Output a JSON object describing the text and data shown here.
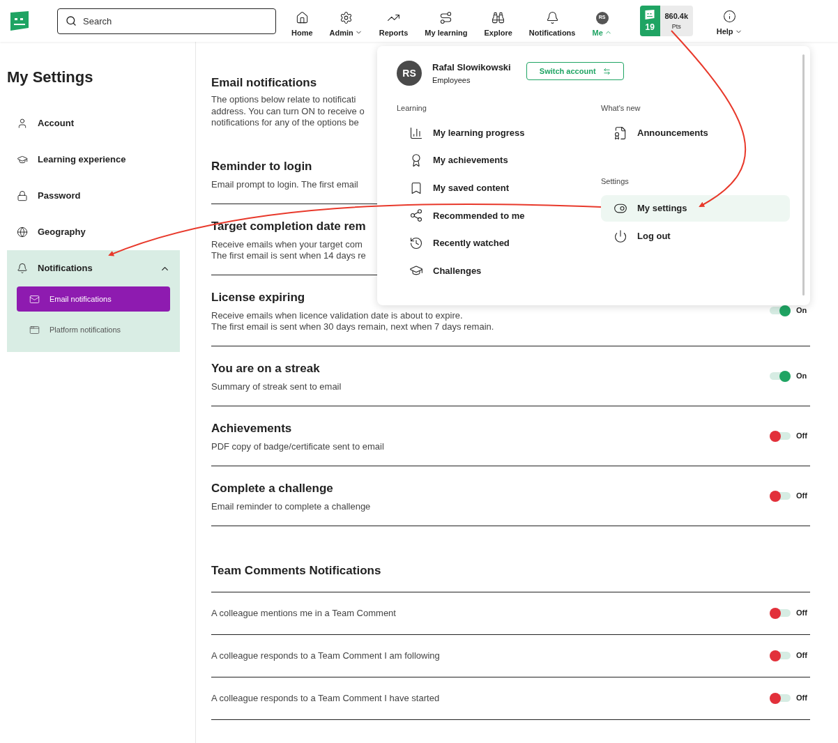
{
  "header": {
    "search": {
      "placeholder": "Search"
    },
    "nav": [
      {
        "label": "Home",
        "caret": false,
        "selected": false
      },
      {
        "label": "Admin",
        "caret": true,
        "selected": false
      },
      {
        "label": "Reports",
        "caret": false,
        "selected": false
      },
      {
        "label": "My learning",
        "caret": false,
        "selected": false
      },
      {
        "label": "Explore",
        "caret": false,
        "selected": false
      },
      {
        "label": "Notifications",
        "caret": false,
        "selected": false
      },
      {
        "label": "Me",
        "caret": true,
        "selected": true,
        "avatar": "RS"
      }
    ],
    "points": {
      "count": "19",
      "value": "860.4k",
      "unit": "Pts"
    },
    "help": {
      "label": "Help",
      "caret": true
    }
  },
  "sidebar": {
    "title": "My Settings",
    "items": [
      {
        "label": "Account"
      },
      {
        "label": "Learning experience"
      },
      {
        "label": "Password"
      },
      {
        "label": "Geography"
      },
      {
        "label": "Notifications",
        "expanded": true,
        "children": [
          {
            "label": "Email notifications",
            "selected": true
          },
          {
            "label": "Platform notifications",
            "selected": false
          }
        ]
      }
    ]
  },
  "main": {
    "intro": {
      "title": "Email notifications",
      "description": [
        "The options below relate to notificati",
        "address. You can turn ON to receive o",
        "notifications for any of the options be"
      ]
    },
    "settings": [
      {
        "title": "Reminder to login",
        "description": [
          "Email prompt to login. The first email"
        ]
      },
      {
        "title": "Target completion date rem",
        "description": [
          "Receive emails when your target com",
          "The first email is sent when 14 days re"
        ]
      },
      {
        "title": "License expiring",
        "description": [
          "Receive emails when licence validation date is about to expire.",
          "The first email is sent when 30 days remain, next when 7 days remain."
        ],
        "toggle": {
          "on": true,
          "label": "On"
        }
      },
      {
        "title": "You are on a streak",
        "description": [
          "Summary of streak sent to email"
        ],
        "toggle": {
          "on": true,
          "label": "On"
        }
      },
      {
        "title": "Achievements",
        "description": [
          "PDF copy of badge/certificate sent to email"
        ],
        "toggle": {
          "on": false,
          "label": "Off"
        }
      },
      {
        "title": "Complete a challenge",
        "description": [
          "Email reminder to complete a challenge"
        ],
        "toggle": {
          "on": false,
          "label": "Off"
        }
      }
    ],
    "team": {
      "title": "Team Comments Notifications",
      "rows": [
        {
          "text": "A colleague mentions me in a Team Comment",
          "on": false,
          "label": "Off"
        },
        {
          "text": "A colleague responds to a Team Comment I am following",
          "on": false,
          "label": "Off"
        },
        {
          "text": "A colleague responds to a Team Comment I have started",
          "on": false,
          "label": "Off"
        }
      ]
    }
  },
  "menu": {
    "user": {
      "initials": "RS",
      "name": "Rafal Slowikowski",
      "group": "Employees"
    },
    "switch_button": "Switch account",
    "learning": {
      "heading": "Learning",
      "items": [
        {
          "label": "My learning progress",
          "selected": false
        },
        {
          "label": "My achievements",
          "selected": false
        },
        {
          "label": "My saved content",
          "selected": false
        },
        {
          "label": "Recommended to me",
          "selected": false
        },
        {
          "label": "Recently watched",
          "selected": false
        },
        {
          "label": "Challenges",
          "selected": false
        }
      ]
    },
    "whats_new": {
      "heading": "What's new",
      "items": [
        {
          "label": "Announcements",
          "selected": false
        }
      ]
    },
    "settings": {
      "heading": "Settings",
      "items": [
        {
          "label": "My settings",
          "selected": true
        },
        {
          "label": "Log out",
          "selected": false
        }
      ]
    }
  }
}
